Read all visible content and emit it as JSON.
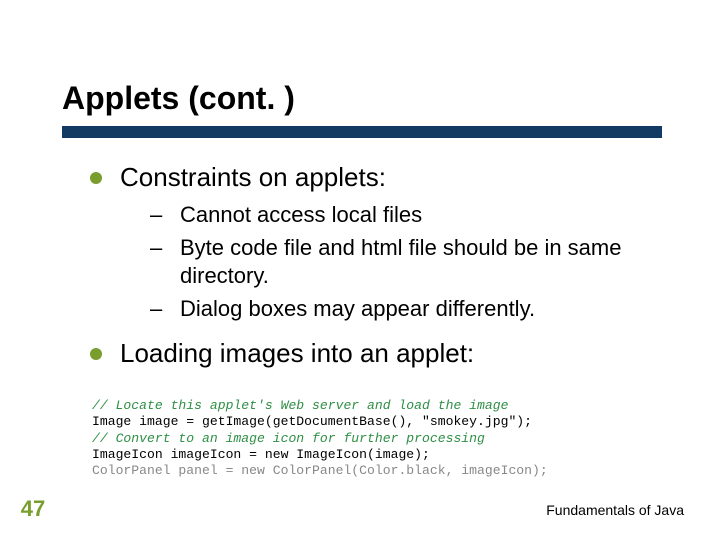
{
  "slide": {
    "title": "Applets (cont. )",
    "number": "47",
    "footer": "Fundamentals of Java"
  },
  "bullets": [
    {
      "text": "Constraints on applets:",
      "subs": [
        "Cannot access local files",
        "Byte code file and html file should be in same directory.",
        "Dialog boxes may appear differently."
      ]
    },
    {
      "text": "Loading images into an applet:",
      "subs": []
    }
  ],
  "code": {
    "lines": [
      {
        "cls": "c",
        "text": "// Locate this applet's Web server and load the image"
      },
      {
        "cls": "k",
        "text": "Image image = getImage(getDocumentBase(), \"smokey.jpg\");"
      },
      {
        "cls": "c",
        "text": "// Convert to an image icon for further processing"
      },
      {
        "cls": "k",
        "text": "ImageIcon imageIcon = new ImageIcon(image);"
      },
      {
        "cls": "s",
        "text": "ColorPanel panel = new ColorPanel(Color.black, imageIcon);"
      }
    ]
  }
}
